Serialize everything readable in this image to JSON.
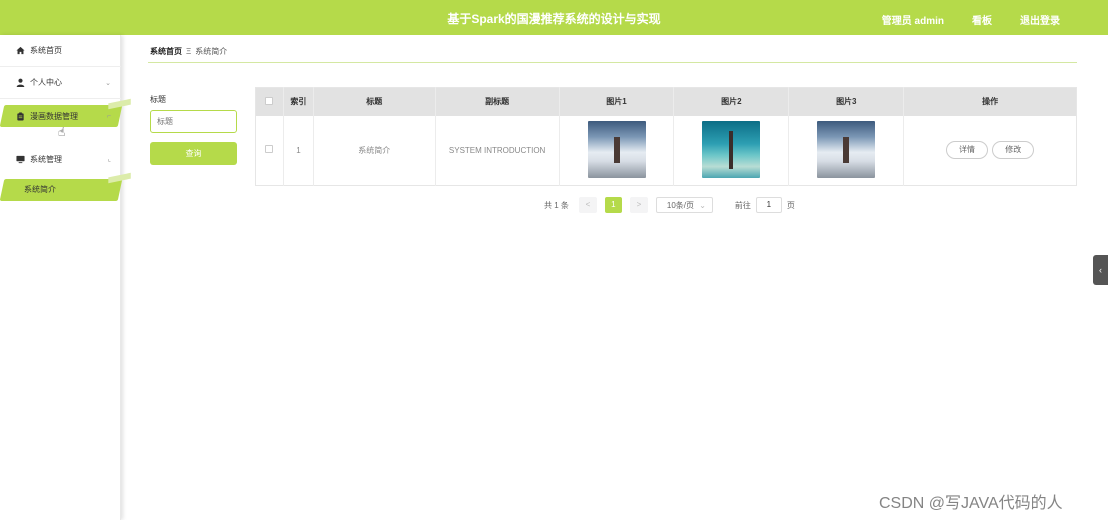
{
  "header": {
    "title": "基于Spark的国漫推荐系统的设计与实现",
    "user_label": "管理员 admin",
    "board_label": "看板",
    "logout_label": "退出登录",
    "accent_color": "#b5da4a"
  },
  "sidebar": {
    "items": [
      {
        "label": "系统首页",
        "icon": "home-icon"
      },
      {
        "label": "个人中心",
        "icon": "user-icon"
      },
      {
        "label": "漫画数据管理",
        "icon": "clipboard-icon"
      },
      {
        "label": "系统管理",
        "icon": "monitor-icon"
      },
      {
        "label": "系统简介",
        "icon": ""
      }
    ]
  },
  "breadcrumb": {
    "root": "系统首页",
    "current": "系统简介"
  },
  "search": {
    "label": "标题",
    "placeholder": "标题",
    "button_label": "查询"
  },
  "table": {
    "headers": [
      "索引",
      "标题",
      "副标题",
      "图片1",
      "图片2",
      "图片3",
      "操作"
    ],
    "rows": [
      {
        "index": "1",
        "title": "系统简介",
        "subtitle": "SYSTEM INTRODUCTION",
        "images": [
          "island-photo",
          "tower-sea-photo",
          "island-photo"
        ],
        "detail_label": "详情",
        "edit_label": "修改"
      }
    ]
  },
  "pagination": {
    "total_text": "共 1 条",
    "prev": "<",
    "current_page": "1",
    "next": ">",
    "page_size": "10条/页",
    "goto_label": "前往",
    "goto_value": "1",
    "page_unit": "页"
  },
  "watermark": "CSDN @写JAVA代码的人"
}
